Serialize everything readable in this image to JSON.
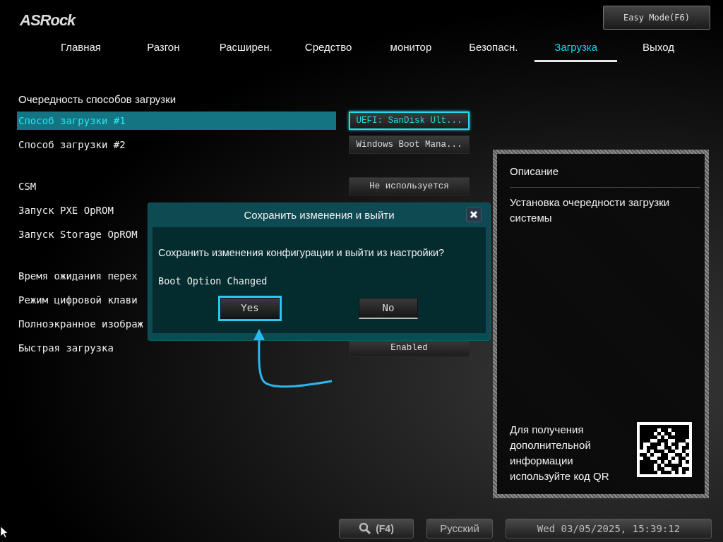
{
  "logo": "ASRock",
  "easy_mode": "Easy Mode(F6)",
  "tabs": [
    {
      "label": "Главная",
      "selected": false
    },
    {
      "label": "Разгон",
      "selected": false
    },
    {
      "label": "Расширен.",
      "selected": false
    },
    {
      "label": "Средство",
      "selected": false
    },
    {
      "label": "монитор",
      "selected": false
    },
    {
      "label": "Безопасн.",
      "selected": false
    },
    {
      "label": "Загрузка",
      "selected": true
    },
    {
      "label": "Выход",
      "selected": false
    }
  ],
  "section_title": "Очередность способов загрузки",
  "groups": [
    {
      "items": [
        {
          "label": "Способ загрузки #1",
          "value": "UEFI: SanDisk Ult...",
          "selected": true
        },
        {
          "label": "Способ загрузки #2",
          "value": "Windows Boot Mana...",
          "selected": false
        }
      ]
    },
    {
      "items": [
        {
          "label": "CSM",
          "value": "Не используется",
          "selected": false
        },
        {
          "label": "Запуск PXE OpROM",
          "selected": false
        },
        {
          "label": "Запуск Storage OpROM",
          "selected": false
        }
      ]
    },
    {
      "items": [
        {
          "label": "Время ожидания перех",
          "selected": false
        },
        {
          "label": "Режим цифровой клави",
          "selected": false
        },
        {
          "label": "Полноэкранное изображ",
          "selected": false
        },
        {
          "label": "Быстрая загрузка",
          "value": "Enabled",
          "selected": false
        }
      ]
    }
  ],
  "description": {
    "title": "Описание",
    "text": "Установка очередности загрузки системы",
    "qr_caption": "Для получения дополнительной информации используйте код QR"
  },
  "dialog": {
    "title": "Сохранить изменения и выйти",
    "message": "Сохранить изменения конфигурации и выйти из настройки?",
    "detail": "Boot Option Changed",
    "buttons": [
      {
        "label": "Yes",
        "selected": true
      },
      {
        "label": "No",
        "selected": false
      }
    ]
  },
  "footer": {
    "search_key": "(F4)",
    "language": "Русский",
    "datetime": "Wed 03/05/2025, 15:39:12"
  }
}
